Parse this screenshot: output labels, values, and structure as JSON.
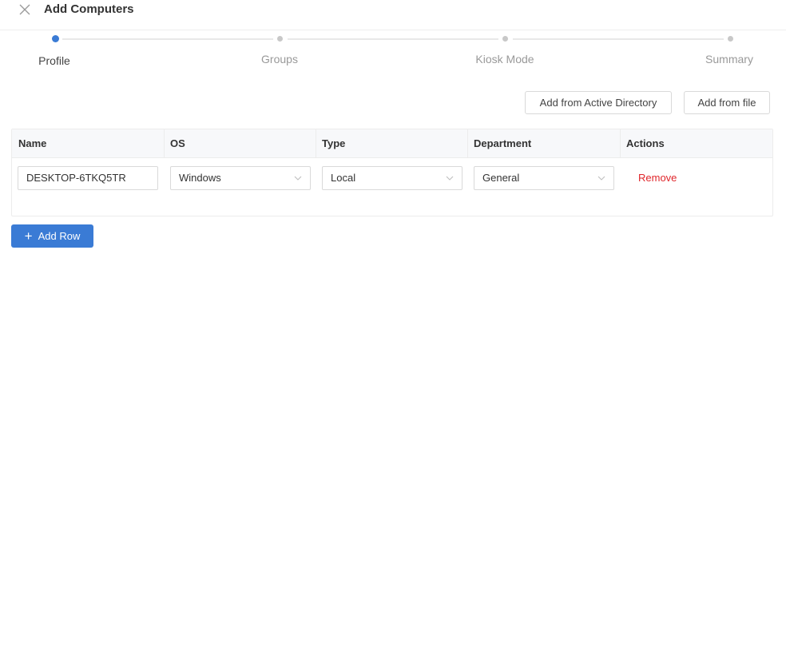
{
  "header": {
    "title": "Add Computers",
    "close_icon": "close-icon"
  },
  "stepper": {
    "steps": [
      {
        "label": "Profile",
        "active": true
      },
      {
        "label": "Groups",
        "active": false
      },
      {
        "label": "Kiosk Mode",
        "active": false
      },
      {
        "label": "Summary",
        "active": false
      }
    ],
    "active_color": "#3a7bd5"
  },
  "actions": {
    "add_from_ad": "Add from Active Directory",
    "add_from_file": "Add from file"
  },
  "table": {
    "columns": [
      "Name",
      "OS",
      "Type",
      "Department",
      "Actions"
    ],
    "rows": [
      {
        "name": "DESKTOP-6TKQ5TR",
        "os": "Windows",
        "type": "Local",
        "department": "General",
        "action": "Remove"
      }
    ]
  },
  "add_row": {
    "label": "Add Row",
    "color": "#3a7bd5"
  },
  "colors": {
    "remove": "#e0262b"
  }
}
